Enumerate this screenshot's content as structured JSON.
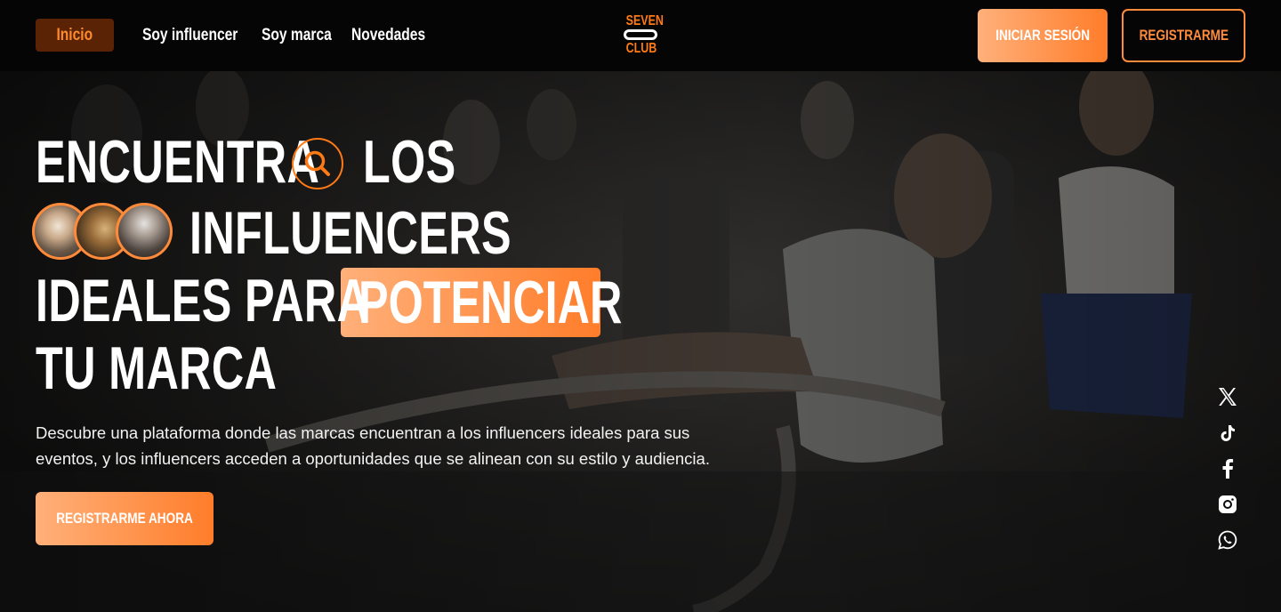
{
  "header": {
    "nav": [
      {
        "label": "Inicio",
        "active": true
      },
      {
        "label": "Soy influencer",
        "active": false
      },
      {
        "label": "Soy marca",
        "active": false
      },
      {
        "label": "Novedades",
        "active": false
      }
    ],
    "logo": {
      "top": "SEVEN",
      "bottom": "CLUB"
    },
    "login_label": "INICIAR SESIÓN",
    "register_label": "REGISTRARME"
  },
  "hero": {
    "line1": "ENCUENTRA",
    "line1b": "LOS",
    "line2": "INFLUENCERS",
    "line3": "IDEALES PARA",
    "highlight": "POTENCIAR",
    "line4": "TU MARCA",
    "description": "Descubre una plataforma donde las marcas encuentran a los influencers ideales para sus eventos, y los influencers acceden a oportunidades que se alinean con su estilo y audiencia.",
    "cta_label": "REGISTRARME AHORA",
    "avatars": [
      "influencer-avatar-1",
      "influencer-avatar-2",
      "influencer-avatar-3"
    ]
  },
  "social": [
    "x-icon",
    "tiktok-icon",
    "facebook-icon",
    "instagram-icon",
    "whatsapp-icon"
  ],
  "colors": {
    "accent": "#ff7a14",
    "accent_light": "#ffb07a",
    "header_bg": "#050505",
    "active_nav_bg": "#5a2306"
  }
}
